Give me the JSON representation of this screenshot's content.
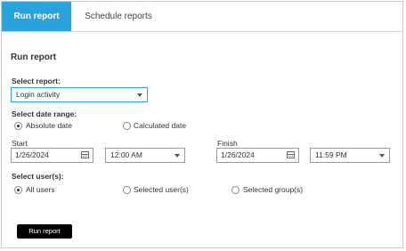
{
  "tabs": {
    "active": "Run report",
    "inactive": "Schedule reports"
  },
  "section_title": "Run report",
  "select_report": {
    "label": "Select report:",
    "value": "Login activity"
  },
  "date_range": {
    "label": "Select date range:",
    "options": [
      "Absolute date",
      "Calculated date"
    ],
    "selected": "Absolute date"
  },
  "start": {
    "label": "Start",
    "date": "1/26/2024",
    "time": "12:00 AM"
  },
  "finish": {
    "label": "Finish",
    "date": "1/26/2024",
    "time": "11:59 PM"
  },
  "users": {
    "label": "Select user(s):",
    "options": [
      "All users",
      "Selected user(s)",
      "Selected group(s)"
    ],
    "selected": "All users"
  },
  "run_button": "Run report",
  "colors": {
    "tab_active": "#29a3db",
    "button": "#000000"
  }
}
